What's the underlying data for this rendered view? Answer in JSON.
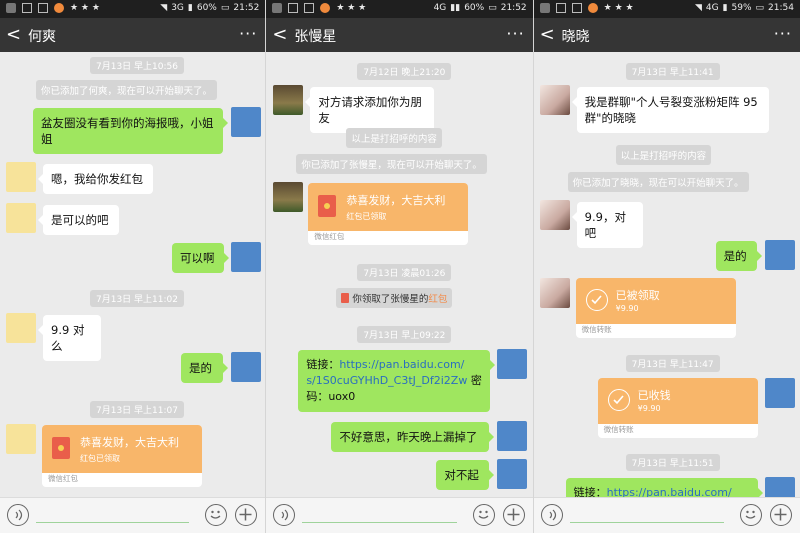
{
  "screens": [
    {
      "status": {
        "battery": "60%",
        "time": "21:52",
        "net": "3G"
      },
      "nav": {
        "back": "<",
        "title": "何爽",
        "more": "···"
      },
      "items": [
        {
          "type": "time",
          "text": "7月13日 早上10:56"
        },
        {
          "type": "sys",
          "text": "你已添加了何爽，现在可以开始聊天了。"
        },
        {
          "type": "out",
          "text": "盆友圈没有看到你的海报哦，小姐姐"
        },
        {
          "type": "in",
          "text": "嗯，我给你发红包"
        },
        {
          "type": "in",
          "text": "是可以的吧"
        },
        {
          "type": "out",
          "text": "可以啊"
        },
        {
          "type": "time",
          "text": "7月13日 早上11:02"
        },
        {
          "type": "in",
          "text": "9.9 对么"
        },
        {
          "type": "out",
          "text": "是的"
        },
        {
          "type": "time",
          "text": "7月13日 早上11:07"
        },
        {
          "type": "redpacket",
          "title": "恭喜发财，大吉大利",
          "status": "红包已领取",
          "label": "微信红包"
        }
      ]
    },
    {
      "status": {
        "battery": "60%",
        "time": "21:52",
        "net": "4G"
      },
      "nav": {
        "back": "<",
        "title": "张慢星",
        "more": "···"
      },
      "items": [
        {
          "type": "time",
          "text": "7月12日 晚上21:20"
        },
        {
          "type": "in",
          "text": "对方请求添加你为朋友"
        },
        {
          "type": "sys",
          "text": "以上是打招呼的内容"
        },
        {
          "type": "sys",
          "text": "你已添加了张慢星，现在可以开始聊天了。"
        },
        {
          "type": "redpacket",
          "title": "恭喜发财，大吉大利",
          "status": "红包已领取",
          "label": "微信红包"
        },
        {
          "type": "time",
          "text": "7月13日 凌晨01:26"
        },
        {
          "type": "tip",
          "prefix": "你领取了张慢星的",
          "highlight": "红包"
        },
        {
          "type": "time",
          "text": "7月13日 早上09:22"
        },
        {
          "type": "out",
          "line1": "链接：",
          "url1": "https://pan.baidu.com/",
          "url2": "s/1S0cuGYHhD_C3tJ_Df2i2Zw",
          "line2": "密",
          "line3": "码：uox0"
        },
        {
          "type": "out",
          "text": "不好意思，昨天晚上漏掉了"
        },
        {
          "type": "out",
          "text": "对不起"
        }
      ]
    },
    {
      "status": {
        "battery": "59%",
        "time": "21:54",
        "net": "4G"
      },
      "nav": {
        "back": "<",
        "title": "晓晓",
        "more": "···"
      },
      "items": [
        {
          "type": "time",
          "text": "7月13日 早上11:41"
        },
        {
          "type": "in",
          "line1": "我是群聊\"个人号裂变涨粉矩阵 95",
          "line2": "群\"的晓晓"
        },
        {
          "type": "sys",
          "text": "以上是打招呼的内容"
        },
        {
          "type": "sys",
          "text": "你已添加了晓晓，现在可以开始聊天了。"
        },
        {
          "type": "in",
          "text": "9.9，对吧"
        },
        {
          "type": "out",
          "text": "是的"
        },
        {
          "type": "transfer",
          "title": "已被领取",
          "amount": "¥9.90",
          "label": "微信转账"
        },
        {
          "type": "time",
          "text": "7月13日 早上11:47"
        },
        {
          "type": "transfer",
          "title": "已收钱",
          "amount": "¥9.90",
          "label": "微信转账"
        },
        {
          "type": "time",
          "text": "7月13日 早上11:51"
        },
        {
          "type": "out",
          "line1": "链接：",
          "url1": "https://pan.baidu.com/"
        }
      ]
    }
  ],
  "colors": {
    "navbar": "#353535",
    "bubble_out": "#9fe65f",
    "card": "#f8b66a",
    "bg": "#ebebeb"
  }
}
